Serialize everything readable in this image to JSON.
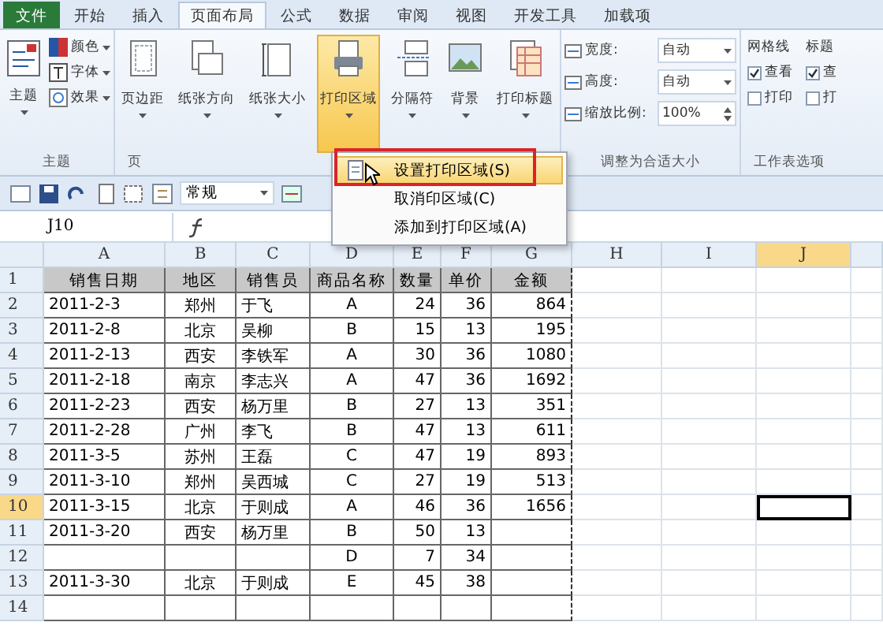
{
  "tabs": [
    {
      "label": "文件",
      "kind": "file",
      "selected": false
    },
    {
      "label": "开始",
      "kind": "tab",
      "selected": false
    },
    {
      "label": "插入",
      "kind": "tab",
      "selected": false
    },
    {
      "label": "页面布局",
      "kind": "tab",
      "selected": true
    },
    {
      "label": "公式",
      "kind": "tab",
      "selected": false
    },
    {
      "label": "数据",
      "kind": "tab",
      "selected": false
    },
    {
      "label": "审阅",
      "kind": "tab",
      "selected": false
    },
    {
      "label": "视图",
      "kind": "tab",
      "selected": false
    },
    {
      "label": "开发工具",
      "kind": "tab",
      "selected": false
    },
    {
      "label": "加载项",
      "kind": "tab",
      "selected": false
    }
  ],
  "ribbon": {
    "theme_group": {
      "label": "主题",
      "big_button": "主题",
      "items": [
        "颜色",
        "字体",
        "效果"
      ]
    },
    "page_setup_group": {
      "label": "页",
      "buttons": [
        {
          "label": "页边距",
          "kind": "margins",
          "pressed": false
        },
        {
          "label": "纸张方向",
          "kind": "orientation",
          "pressed": false
        },
        {
          "label": "纸张大小",
          "kind": "size",
          "pressed": false
        },
        {
          "label": "打印区域",
          "kind": "printarea",
          "pressed": true
        },
        {
          "label": "分隔符",
          "kind": "breaks",
          "pressed": false
        },
        {
          "label": "背景",
          "kind": "background",
          "pressed": false
        },
        {
          "label": "打印标题",
          "kind": "titles",
          "pressed": false
        }
      ]
    },
    "scale_group": {
      "label": "调整为合适大小",
      "fields": [
        {
          "label": "宽度:",
          "value": "自动",
          "kind": "dropdown"
        },
        {
          "label": "高度:",
          "value": "自动",
          "kind": "dropdown"
        },
        {
          "label": "缩放比例:",
          "value": "100%",
          "kind": "spinner"
        }
      ]
    },
    "sheet_options_group": {
      "label": "工作表选项",
      "columns": [
        {
          "heading": "网格线",
          "options": [
            {
              "label": "查看",
              "checked": true
            },
            {
              "label": "打印",
              "checked": false
            }
          ]
        },
        {
          "heading": "标题",
          "options": [
            {
              "label": "查",
              "checked": true
            },
            {
              "label": "打",
              "checked": false
            }
          ]
        }
      ]
    }
  },
  "quick_access": {
    "number_format": "常规"
  },
  "formula_bar": {
    "name_box": "J10"
  },
  "print_area_menu": {
    "items": [
      {
        "label": "设置打印区域(S)",
        "selected": true
      },
      {
        "label": "取消印区域(C)",
        "selected": false
      },
      {
        "label": "添加到打印区域(A)",
        "selected": false
      }
    ]
  },
  "sheet": {
    "columns": [
      {
        "label": "A",
        "selected": false
      },
      {
        "label": "B",
        "selected": false
      },
      {
        "label": "C",
        "selected": false
      },
      {
        "label": "D",
        "selected": false
      },
      {
        "label": "E",
        "selected": false
      },
      {
        "label": "F",
        "selected": false
      },
      {
        "label": "G",
        "selected": false
      },
      {
        "label": "H",
        "selected": false
      },
      {
        "label": "I",
        "selected": false
      },
      {
        "label": "J",
        "selected": true
      }
    ],
    "rows": [
      {
        "number": "1",
        "kind": "header",
        "selected": false,
        "cells": {
          "A": "销售日期",
          "B": "地区",
          "C": "销售员",
          "D": "商品名称",
          "E": "数量",
          "F": "单价",
          "G": "金额"
        }
      },
      {
        "number": "2",
        "kind": "data",
        "selected": false,
        "cells": {
          "A": "2011-2-3",
          "B": "郑州",
          "C": "于飞",
          "D": "A",
          "E": "24",
          "F": "36",
          "G": "864"
        }
      },
      {
        "number": "3",
        "kind": "data",
        "selected": false,
        "cells": {
          "A": "2011-2-8",
          "B": "北京",
          "C": "吴柳",
          "D": "B",
          "E": "15",
          "F": "13",
          "G": "195"
        }
      },
      {
        "number": "4",
        "kind": "data",
        "selected": false,
        "cells": {
          "A": "2011-2-13",
          "B": "西安",
          "C": "李铁军",
          "D": "A",
          "E": "30",
          "F": "36",
          "G": "1080"
        }
      },
      {
        "number": "5",
        "kind": "data",
        "selected": false,
        "cells": {
          "A": "2011-2-18",
          "B": "南京",
          "C": "李志兴",
          "D": "A",
          "E": "47",
          "F": "36",
          "G": "1692"
        }
      },
      {
        "number": "6",
        "kind": "data",
        "selected": false,
        "cells": {
          "A": "2011-2-23",
          "B": "西安",
          "C": "杨万里",
          "D": "B",
          "E": "27",
          "F": "13",
          "G": "351"
        }
      },
      {
        "number": "7",
        "kind": "data",
        "selected": false,
        "cells": {
          "A": "2011-2-28",
          "B": "广州",
          "C": "李飞",
          "D": "B",
          "E": "47",
          "F": "13",
          "G": "611"
        }
      },
      {
        "number": "8",
        "kind": "data",
        "selected": false,
        "cells": {
          "A": "2011-3-5",
          "B": "苏州",
          "C": "王磊",
          "D": "C",
          "E": "47",
          "F": "19",
          "G": "893"
        }
      },
      {
        "number": "9",
        "kind": "data",
        "selected": false,
        "cells": {
          "A": "2011-3-10",
          "B": "郑州",
          "C": "吴西城",
          "D": "C",
          "E": "27",
          "F": "19",
          "G": "513"
        }
      },
      {
        "number": "10",
        "kind": "data",
        "selected": true,
        "cells": {
          "A": "2011-3-15",
          "B": "北京",
          "C": "于则成",
          "D": "A",
          "E": "46",
          "F": "36",
          "G": "1656"
        }
      },
      {
        "number": "11",
        "kind": "data",
        "selected": false,
        "cells": {
          "A": "2011-3-20",
          "B": "西安",
          "C": "杨万里",
          "D": "B",
          "E": "50",
          "F": "13"
        }
      },
      {
        "number": "12",
        "kind": "data",
        "selected": false,
        "cells": {
          "D": "D",
          "E": "7",
          "F": "34"
        }
      },
      {
        "number": "13",
        "kind": "data",
        "selected": false,
        "cells": {
          "A": "2011-3-30",
          "B": "北京",
          "C": "于则成",
          "D": "E",
          "E": "45",
          "F": "38"
        }
      },
      {
        "number": "14",
        "kind": "data",
        "selected": false,
        "cells": {}
      }
    ]
  }
}
